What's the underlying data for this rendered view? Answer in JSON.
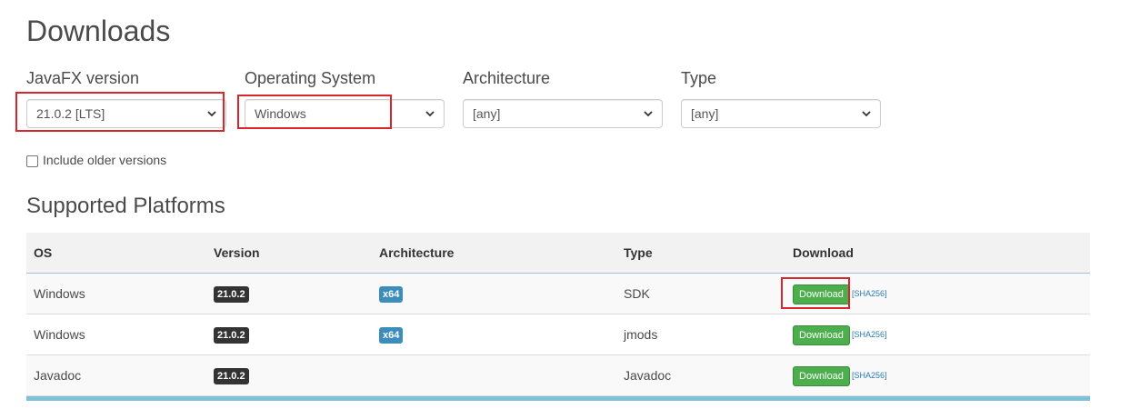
{
  "page": {
    "title": "Downloads"
  },
  "filters": {
    "javafx_version": {
      "label": "JavaFX version",
      "value": "21.0.2 [LTS]"
    },
    "operating_system": {
      "label": "Operating System",
      "value": "Windows"
    },
    "architecture": {
      "label": "Architecture",
      "value": "[any]"
    },
    "type": {
      "label": "Type",
      "value": "[any]"
    }
  },
  "include_older": {
    "label": "Include older versions",
    "checked": false
  },
  "platforms": {
    "title": "Supported Platforms",
    "headers": {
      "os": "OS",
      "version": "Version",
      "architecture": "Architecture",
      "type": "Type",
      "download": "Download"
    },
    "rows": [
      {
        "os": "Windows",
        "version": "21.0.2",
        "architecture": "x64",
        "type": "SDK",
        "download_label": "Download",
        "sha_label": "[SHA256]"
      },
      {
        "os": "Windows",
        "version": "21.0.2",
        "architecture": "x64",
        "type": "jmods",
        "download_label": "Download",
        "sha_label": "[SHA256]"
      },
      {
        "os": "Javadoc",
        "version": "21.0.2",
        "architecture": "",
        "type": "Javadoc",
        "download_label": "Download",
        "sha_label": "[SHA256]"
      }
    ]
  },
  "colors": {
    "highlight": "#d7262c",
    "download_button": "#4cae4c",
    "arch_badge": "#3c8dbc",
    "version_badge": "#333333"
  }
}
